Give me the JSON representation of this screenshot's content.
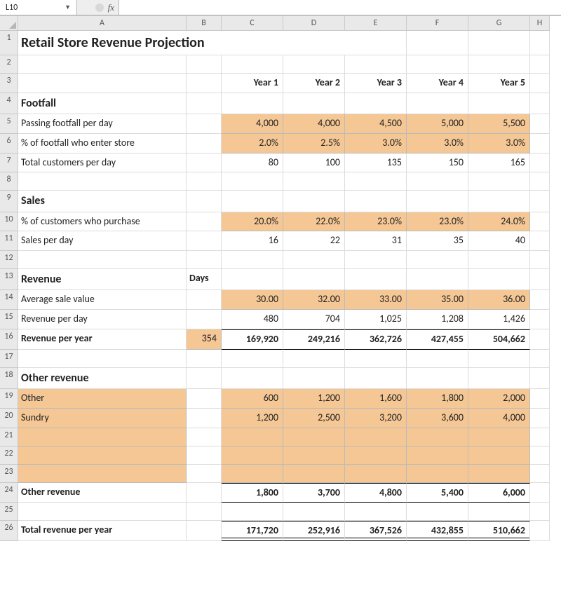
{
  "namebox": "L10",
  "fx_label": "fx",
  "formula_value": "",
  "columns": [
    "A",
    "B",
    "C",
    "D",
    "E",
    "F",
    "G",
    "H"
  ],
  "row_numbers": [
    "1",
    "2",
    "3",
    "4",
    "5",
    "6",
    "7",
    "8",
    "9",
    "10",
    "11",
    "12",
    "13",
    "14",
    "15",
    "16",
    "17",
    "18",
    "19",
    "20",
    "21",
    "22",
    "23",
    "24",
    "25",
    "26"
  ],
  "title": "Retail Store Revenue Projection",
  "year_headers": [
    "Year 1",
    "Year 2",
    "Year 3",
    "Year 4",
    "Year 5"
  ],
  "sections": {
    "footfall": "Footfall",
    "sales": "Sales",
    "revenue": "Revenue",
    "other": "Other revenue"
  },
  "labels": {
    "passing": "Passing footfall per day",
    "enter_pct": "% of footfall who enter store",
    "total_cust": "Total customers per day",
    "purchase_pct": "% of customers who purchase",
    "sales_day": "Sales per day",
    "days": "Days",
    "avg_sale": "Average sale value",
    "rev_day": "Revenue per day",
    "rev_year": "Revenue per year",
    "other": "Other",
    "sundry": "Sundry",
    "other_rev": "Other revenue",
    "total_rev": "Total revenue per year"
  },
  "values": {
    "passing": [
      "4,000",
      "4,000",
      "4,500",
      "5,000",
      "5,500"
    ],
    "enter_pct": [
      "2.0%",
      "2.5%",
      "3.0%",
      "3.0%",
      "3.0%"
    ],
    "total_cust": [
      "80",
      "100",
      "135",
      "150",
      "165"
    ],
    "purchase_pct": [
      "20.0%",
      "22.0%",
      "23.0%",
      "23.0%",
      "24.0%"
    ],
    "sales_day": [
      "16",
      "22",
      "31",
      "35",
      "40"
    ],
    "avg_sale": [
      "30.00",
      "32.00",
      "33.00",
      "35.00",
      "36.00"
    ],
    "rev_day": [
      "480",
      "704",
      "1,025",
      "1,208",
      "1,426"
    ],
    "days": "354",
    "rev_year": [
      "169,920",
      "249,216",
      "362,726",
      "427,455",
      "504,662"
    ],
    "other": [
      "600",
      "1,200",
      "1,600",
      "1,800",
      "2,000"
    ],
    "sundry": [
      "1,200",
      "2,500",
      "3,200",
      "3,600",
      "4,000"
    ],
    "other_rev": [
      "1,800",
      "3,700",
      "4,800",
      "5,400",
      "6,000"
    ],
    "total_rev": [
      "171,720",
      "252,916",
      "367,526",
      "432,855",
      "510,662"
    ]
  },
  "chart_data": {
    "type": "table",
    "title": "Retail Store Revenue Projection",
    "columns": [
      "Year 1",
      "Year 2",
      "Year 3",
      "Year 4",
      "Year 5"
    ],
    "rows": [
      {
        "label": "Passing footfall per day",
        "values": [
          4000,
          4000,
          4500,
          5000,
          5500
        ]
      },
      {
        "label": "% of footfall who enter store",
        "values": [
          0.02,
          0.025,
          0.03,
          0.03,
          0.03
        ]
      },
      {
        "label": "Total customers per day",
        "values": [
          80,
          100,
          135,
          150,
          165
        ]
      },
      {
        "label": "% of customers who purchase",
        "values": [
          0.2,
          0.22,
          0.23,
          0.23,
          0.24
        ]
      },
      {
        "label": "Sales per day",
        "values": [
          16,
          22,
          31,
          35,
          40
        ]
      },
      {
        "label": "Average sale value",
        "values": [
          30.0,
          32.0,
          33.0,
          35.0,
          36.0
        ]
      },
      {
        "label": "Revenue per day",
        "values": [
          480,
          704,
          1025,
          1208,
          1426
        ]
      },
      {
        "label": "Revenue per year (Days 354)",
        "values": [
          169920,
          249216,
          362726,
          427455,
          504662
        ]
      },
      {
        "label": "Other",
        "values": [
          600,
          1200,
          1600,
          1800,
          2000
        ]
      },
      {
        "label": "Sundry",
        "values": [
          1200,
          2500,
          3200,
          3600,
          4000
        ]
      },
      {
        "label": "Other revenue",
        "values": [
          1800,
          3700,
          4800,
          5400,
          6000
        ]
      },
      {
        "label": "Total revenue per year",
        "values": [
          171720,
          252916,
          367526,
          432855,
          510662
        ]
      }
    ]
  }
}
